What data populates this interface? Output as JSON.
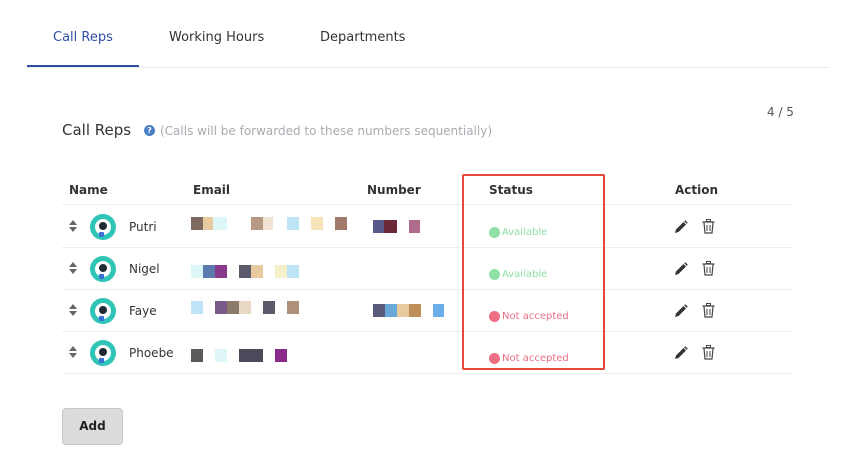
{
  "tabs": [
    {
      "label": "Call Reps",
      "active": true
    },
    {
      "label": "Working Hours",
      "active": false
    },
    {
      "label": "Departments",
      "active": false
    }
  ],
  "page_counter": "4 / 5",
  "section": {
    "title": "Call Reps",
    "help_icon": "question-circle-icon",
    "hint": "(Calls will be forwarded to these numbers sequentially)"
  },
  "table": {
    "columns": [
      "Name",
      "Email",
      "Number",
      "Status",
      "Action"
    ],
    "rows": [
      {
        "name": "Putri",
        "status": "Available",
        "status_color": "#8ee0a6"
      },
      {
        "name": "Nigel",
        "status": "Available",
        "status_color": "#8ee0a6"
      },
      {
        "name": "Faye",
        "status": "Not accepted",
        "status_color": "#ee6e84"
      },
      {
        "name": "Phoebe",
        "status": "Not accepted",
        "status_color": "#ee6e84"
      }
    ],
    "action_icons": [
      "pencil-icon",
      "trash-icon"
    ]
  },
  "add_button_label": "Add",
  "colors": {
    "accent": "#2f4fa3",
    "available": "#8ee0a6",
    "not_accepted": "#ee6e84",
    "highlight_box": "#e8463a"
  }
}
